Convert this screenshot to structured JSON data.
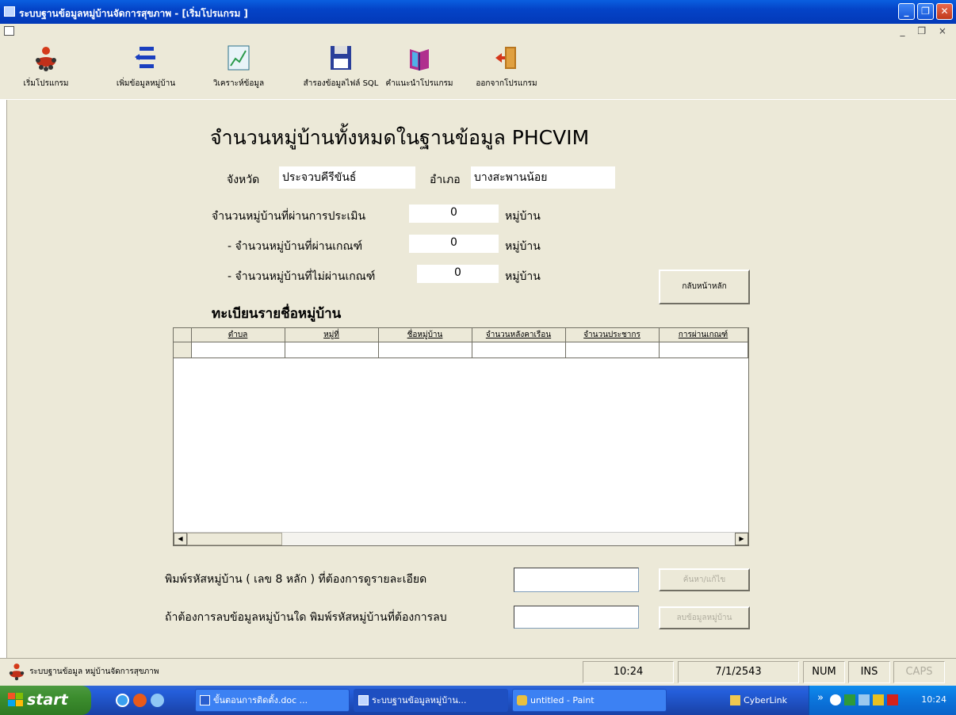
{
  "window": {
    "title": "ระบบฐานข้อมูลหมู่บ้านจัดการสุขภาพ - [เริ่มโปรแกรม ]",
    "minimize": "_",
    "maximize": "❐",
    "close": "✕"
  },
  "mdi": {
    "controls": "_ ❐ ×"
  },
  "toolbar": {
    "items": [
      {
        "label": "เริ่มโปรแกรม",
        "icon": "people-round-table-icon"
      },
      {
        "label": "เพิ่มข้อมูลหมู่บ้าน",
        "icon": "add-arrows-icon"
      },
      {
        "label": "วิเคราะห์ข้อมูล",
        "icon": "chart-icon"
      },
      {
        "label": "สำรองข้อมูลไฟล์ SQL",
        "icon": "floppy-disk-icon"
      },
      {
        "label": "คำแนะนำโปรแกรม",
        "icon": "book-icon"
      },
      {
        "label": "ออกจากโปรแกรม",
        "icon": "exit-door-icon"
      }
    ]
  },
  "form": {
    "heading": "จำนวนหมู่บ้านทั้งหมดในฐานข้อมูล PHCVIM",
    "province_label": "จังหวัด",
    "province_value": "ประจวบคีรีขันธ์",
    "district_label": "อำเภอ",
    "district_value": "บางสะพานน้อย",
    "assessed_label": "จำนวนหมู่บ้านที่ผ่านการประเมิน",
    "assessed_value": "0",
    "passed_label": "- จำนวนหมู่บ้านที่ผ่านเกณฑ์",
    "passed_value": "0",
    "failed_label": "- จำนวนหมู่บ้านที่ไม่ผ่านเกณฑ์",
    "failed_value": "0",
    "unit": "หมู่บ้าน",
    "back_button": "กลับหน้าหลัก",
    "registry_title": "ทะเบียนรายชื่อหมู่บ้าน",
    "grid_columns": [
      "ตำบล",
      "หมู่ที่",
      "ชื่อหมู่บ้าน",
      "จำนวนหลังคาเรือน",
      "จำนวนประชากร",
      "การผ่านเกณฑ์"
    ],
    "search_label": "พิมพ์รหัสหมู่บ้าน ( เลข 8 หลัก ) ที่ต้องการดูรายละเอียด",
    "search_button": "ค้นหา/แก้ไข",
    "delete_label": "ถ้าต้องการลบข้อมูลหมู่บ้านใด พิมพ์รหัสหมู่บ้านที่ต้องการลบ",
    "delete_button": "ลบข้อมูลหมู่บ้าน"
  },
  "statusbar": {
    "text": "ระบบฐานข้อมูล หมู่บ้านจัดการสุขภาพ",
    "time": "10:24",
    "date": "7/1/2543",
    "num": "NUM",
    "ins": "INS",
    "caps": "CAPS"
  },
  "taskbar": {
    "start": "start",
    "tasks": [
      {
        "label": "ขั้นตอนการติดตั้ง.doc ...",
        "icon": "word-doc-icon"
      },
      {
        "label": "ระบบฐานข้อมูลหมู่บ้าน...",
        "icon": "app-window-icon"
      },
      {
        "label": "untitled - Paint",
        "icon": "paint-icon"
      }
    ],
    "folder": "CyberLink",
    "chevron": "»",
    "clock": "10:24"
  }
}
